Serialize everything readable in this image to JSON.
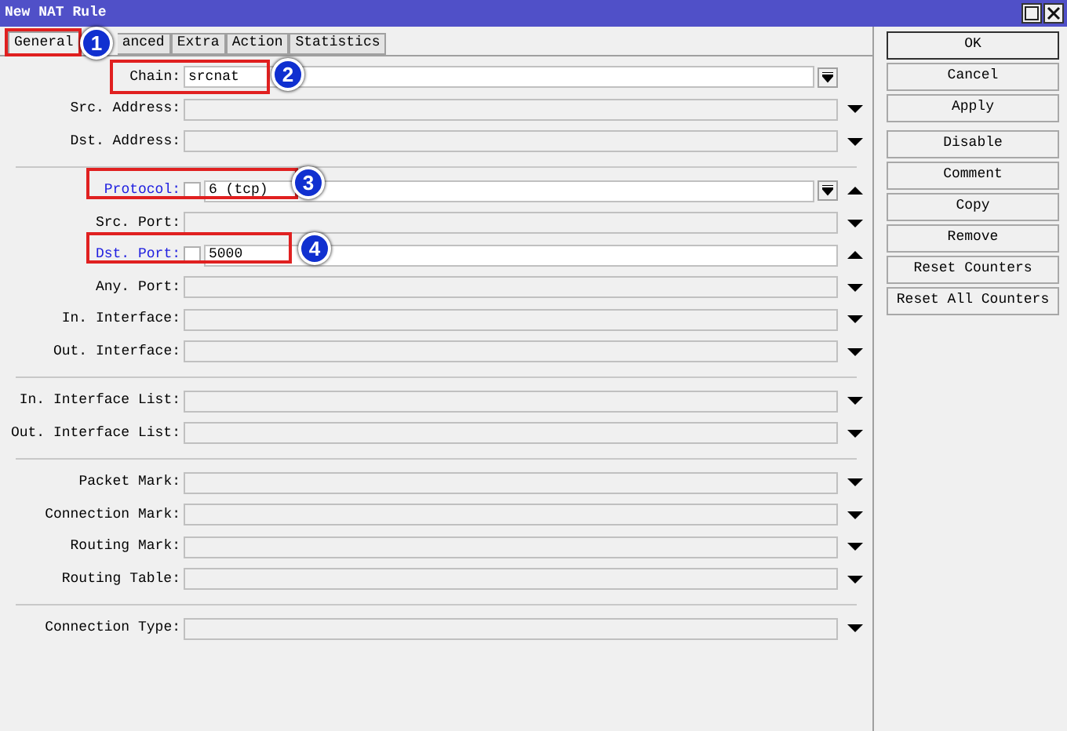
{
  "window": {
    "title": "New NAT Rule"
  },
  "tabs": [
    {
      "label": "General",
      "selected": true
    },
    {
      "label": "anced",
      "selected": false
    },
    {
      "label": "Extra",
      "selected": false
    },
    {
      "label": "Action",
      "selected": false
    },
    {
      "label": "Statistics",
      "selected": false
    }
  ],
  "sections": [
    {
      "rows": [
        {
          "label": "Chain:",
          "value": "srcnat",
          "highlighted": false,
          "dropdown": true
        },
        {
          "label": "Src. Address:",
          "highlighted": false,
          "expanded": false
        },
        {
          "label": "Dst. Address:",
          "highlighted": false,
          "expanded": false
        }
      ]
    },
    {
      "rows": [
        {
          "label": "Protocol:",
          "value": "6 (tcp)",
          "highlighted": true,
          "negated": false,
          "dropdown": true,
          "expanded": true
        },
        {
          "label": "Src. Port:",
          "highlighted": false,
          "expanded": false
        },
        {
          "label": "Dst. Port:",
          "value": "5000",
          "highlighted": true,
          "negated": false,
          "expanded": true
        },
        {
          "label": "Any. Port:",
          "highlighted": false,
          "expanded": false
        },
        {
          "label": "In. Interface:",
          "highlighted": false,
          "expanded": false
        },
        {
          "label": "Out. Interface:",
          "highlighted": false,
          "expanded": false
        }
      ]
    },
    {
      "rows": [
        {
          "label": "In. Interface List:",
          "highlighted": false,
          "expanded": false
        },
        {
          "label": "Out. Interface List:",
          "highlighted": false,
          "expanded": false
        }
      ]
    },
    {
      "rows": [
        {
          "label": "Packet Mark:",
          "highlighted": false,
          "expanded": false
        },
        {
          "label": "Connection Mark:",
          "highlighted": false,
          "expanded": false
        },
        {
          "label": "Routing Mark:",
          "highlighted": false,
          "expanded": false
        },
        {
          "label": "Routing Table:",
          "highlighted": false,
          "expanded": false
        }
      ]
    },
    {
      "rows": [
        {
          "label": "Connection Type:",
          "highlighted": false,
          "expanded": false
        }
      ]
    }
  ],
  "button_groups": [
    [
      {
        "label": "OK",
        "default": true
      },
      {
        "label": "Cancel",
        "default": false
      },
      {
        "label": "Apply",
        "default": false
      }
    ],
    [
      {
        "label": "Disable",
        "default": false
      },
      {
        "label": "Comment",
        "default": false
      },
      {
        "label": "Copy",
        "default": false
      },
      {
        "label": "Remove",
        "default": false
      },
      {
        "label": "Reset Counters",
        "default": false
      },
      {
        "label": "Reset All Counters",
        "default": false
      }
    ]
  ],
  "callouts": [
    {
      "number": "1"
    },
    {
      "number": "2"
    },
    {
      "number": "3"
    },
    {
      "number": "4"
    }
  ]
}
